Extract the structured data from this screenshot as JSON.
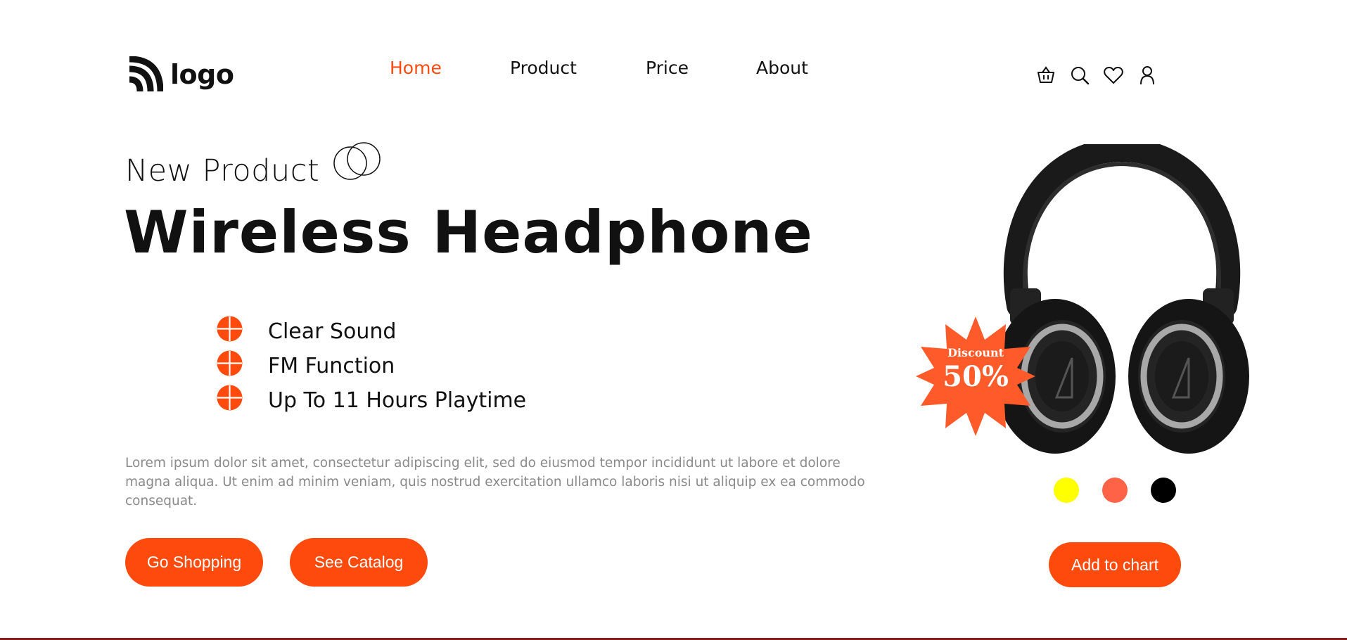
{
  "brand": {
    "logo_text": "logo"
  },
  "nav": {
    "items": [
      {
        "label": "Home",
        "active": true
      },
      {
        "label": "Product",
        "active": false
      },
      {
        "label": "Price",
        "active": false
      },
      {
        "label": "About",
        "active": false
      }
    ]
  },
  "header_icons": [
    "basket-icon",
    "search-icon",
    "heart-icon",
    "user-icon"
  ],
  "hero": {
    "subtitle": "New Product",
    "title": "Wireless Headphone",
    "features": [
      "Clear Sound",
      "FM Function",
      "Up To 11 Hours Playtime"
    ],
    "description": "Lorem ipsum dolor sit amet, consectetur adipiscing elit, sed do eiusmod tempor incididunt ut labore et dolore magna aliqua. Ut enim ad minim veniam, quis nostrud exercitation ullamco laboris nisi ut aliquip ex ea commodo consequat.",
    "buttons": {
      "shop": "Go Shopping",
      "catalog": "See Catalog"
    }
  },
  "product": {
    "discount_label": "Discount",
    "discount_value": "50%",
    "colors": [
      "#ffff00",
      "#ff6347",
      "#000000"
    ],
    "add_to_cart": "Add to chart"
  },
  "theme": {
    "accent": "#ff4a0d",
    "badge": "#ff5a2a",
    "text": "#111111",
    "muted": "#8a8a8a"
  }
}
